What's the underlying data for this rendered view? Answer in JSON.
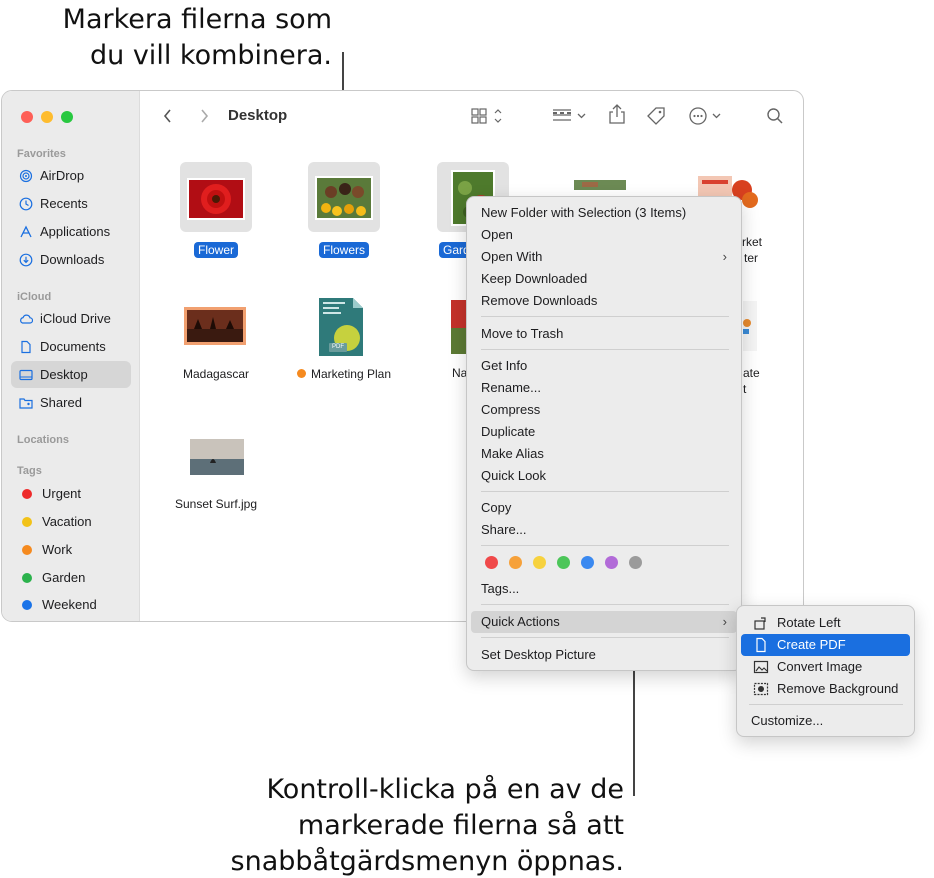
{
  "callouts": {
    "top_line1": "Markera filerna som",
    "top_line2": "du vill kombinera.",
    "bottom_line1": "Kontroll-klicka på en av de",
    "bottom_line2": "markerade filerna så att",
    "bottom_line3": "snabbåtgärdsmenyn öppnas."
  },
  "window": {
    "title": "Desktop",
    "traffic_lights": [
      "#fe5f57",
      "#febc2e",
      "#28c840"
    ]
  },
  "sidebar": {
    "favorites_header": "Favorites",
    "favorites": [
      {
        "label": "AirDrop",
        "icon": "airdrop-icon"
      },
      {
        "label": "Recents",
        "icon": "clock-icon"
      },
      {
        "label": "Applications",
        "icon": "applications-icon"
      },
      {
        "label": "Downloads",
        "icon": "download-icon"
      }
    ],
    "icloud_header": "iCloud",
    "icloud": [
      {
        "label": "iCloud Drive",
        "icon": "cloud-icon"
      },
      {
        "label": "Documents",
        "icon": "document-icon"
      },
      {
        "label": "Desktop",
        "icon": "desktop-icon",
        "selected": true
      },
      {
        "label": "Shared",
        "icon": "shared-folder-icon"
      }
    ],
    "locations_header": "Locations",
    "tags_header": "Tags",
    "tags": [
      {
        "label": "Urgent",
        "color": "#ee2a2a"
      },
      {
        "label": "Vacation",
        "color": "#f2c218"
      },
      {
        "label": "Work",
        "color": "#f58a1f"
      },
      {
        "label": "Garden",
        "color": "#2bb24c"
      },
      {
        "label": "Weekend",
        "color": "#1a73e8"
      }
    ]
  },
  "files": {
    "flower": "Flower",
    "flowers": "Flowers",
    "garden_partial": "Gard",
    "market_partial_1": "rket",
    "market_partial_2": "ter",
    "madagascar": "Madagascar",
    "marketing_plan": "Marketing Plan",
    "marketing_plan_tag_color": "#f58a1f",
    "na_partial": "Na",
    "ate_partial_1": "ate",
    "ate_partial_2": "t",
    "sunset_surf": "Sunset Surf.jpg",
    "pdf_badge": "PDF"
  },
  "context_menu": {
    "new_folder": "New Folder with Selection (3 Items)",
    "open": "Open",
    "open_with": "Open With",
    "keep_downloaded": "Keep Downloaded",
    "remove_downloads": "Remove Downloads",
    "move_to_trash": "Move to Trash",
    "get_info": "Get Info",
    "rename": "Rename...",
    "compress": "Compress",
    "duplicate": "Duplicate",
    "make_alias": "Make Alias",
    "quick_look": "Quick Look",
    "copy": "Copy",
    "share": "Share...",
    "tag_colors": [
      "#f0494a",
      "#f6a13a",
      "#f7d23e",
      "#4cc659",
      "#3a89f0",
      "#b26bd8",
      "#9b9b9b"
    ],
    "tags": "Tags...",
    "quick_actions": "Quick Actions",
    "set_desktop_picture": "Set Desktop Picture"
  },
  "submenu": {
    "rotate_left": "Rotate Left",
    "create_pdf": "Create PDF",
    "convert_image": "Convert Image",
    "remove_background": "Remove Background",
    "customize": "Customize..."
  }
}
